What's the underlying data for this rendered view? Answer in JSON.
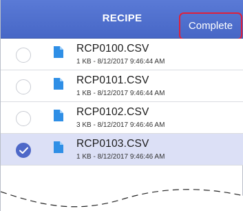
{
  "header": {
    "title": "RECIPE",
    "complete_label": "Complete"
  },
  "files": [
    {
      "name": "RCP0100.CSV",
      "meta": "1 KB - 8/12/2017 9:46:44 AM",
      "selected": false
    },
    {
      "name": "RCP0101.CSV",
      "meta": "1 KB - 8/12/2017 9:46:44 AM",
      "selected": false
    },
    {
      "name": "RCP0102.CSV",
      "meta": "3 KB - 8/12/2017 9:46:46 AM",
      "selected": false
    },
    {
      "name": "RCP0103.CSV",
      "meta": "1 KB - 8/12/2017 9:46:46 AM",
      "selected": true
    }
  ],
  "colors": {
    "header": "#4e6dcc",
    "selected_row": "#dce0f6",
    "checkbox_checked": "#4e68c8",
    "file_icon": "#2f8fe6",
    "highlight_border": "#e0203a"
  },
  "icons": {
    "file": "document-icon",
    "check": "checkmark-icon"
  }
}
